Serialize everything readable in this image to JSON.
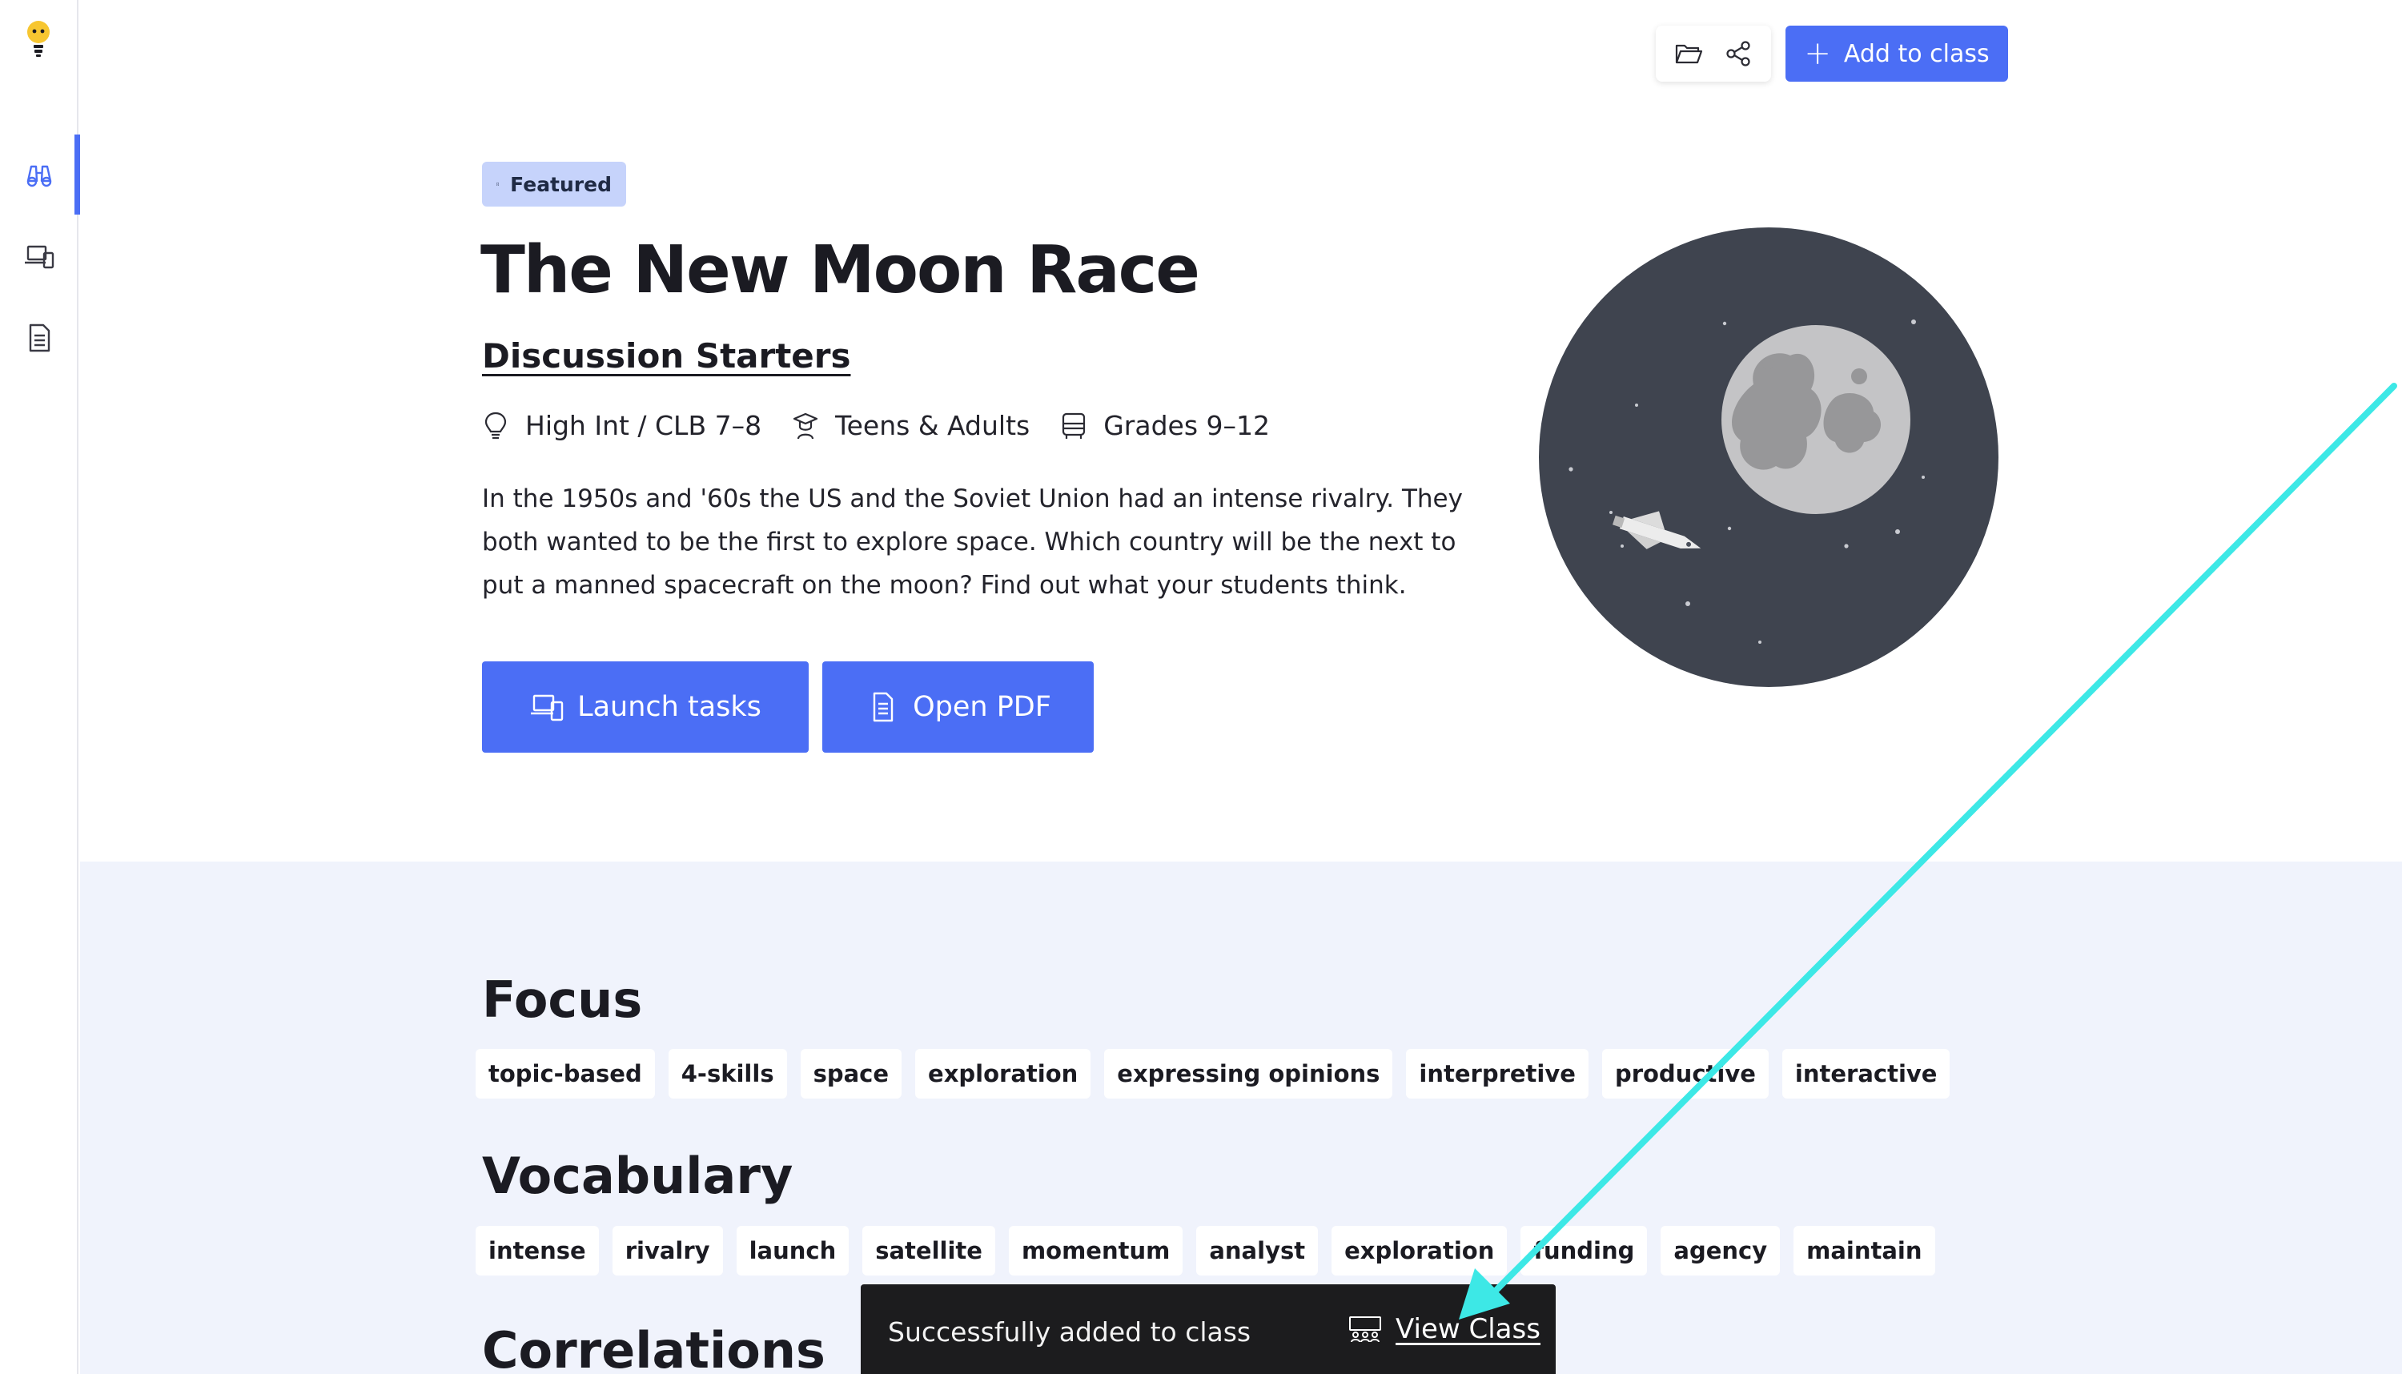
{
  "sidebar": {
    "items": [
      {
        "icon": "binoculars-icon",
        "active": true
      },
      {
        "icon": "devices-icon",
        "active": false
      },
      {
        "icon": "document-icon",
        "active": false
      }
    ]
  },
  "toolbar": {
    "add_label": "Add to class",
    "plus": "+"
  },
  "lesson": {
    "badge": "Featured",
    "title": "The New Moon Race",
    "category": "Discussion Starters",
    "level": "High Int / CLB 7–8",
    "audience": "Teens & Adults",
    "grades": "Grades 9–12",
    "description": "In the 1950s and '60s the US and the Soviet Union had an intense rivalry. They both wanted to be the first to explore space. Which country will be the next to put a manned spacecraft on the moon? Find out what your students think.",
    "launch_label": "Launch tasks",
    "pdf_label": "Open PDF"
  },
  "sections": {
    "focus_title": "Focus",
    "focus_tags": [
      "topic-based",
      "4-skills",
      "space",
      "exploration",
      "expressing opinions",
      "interpretive",
      "productive",
      "interactive"
    ],
    "vocab_title": "Vocabulary",
    "vocab_tags": [
      "intense",
      "rivalry",
      "launch",
      "satellite",
      "momentum",
      "analyst",
      "exploration",
      "funding",
      "agency",
      "maintain"
    ],
    "correlations_title": "Correlations"
  },
  "snackbar": {
    "message": "Successfully added to class",
    "action": "View Class"
  },
  "colors": {
    "accent": "#4b6ef5",
    "badge_bg": "#c6d3fb",
    "lower_bg": "#f0f3fc",
    "snackbar_bg": "#1c1c1e",
    "annotation": "#3de8e6"
  }
}
